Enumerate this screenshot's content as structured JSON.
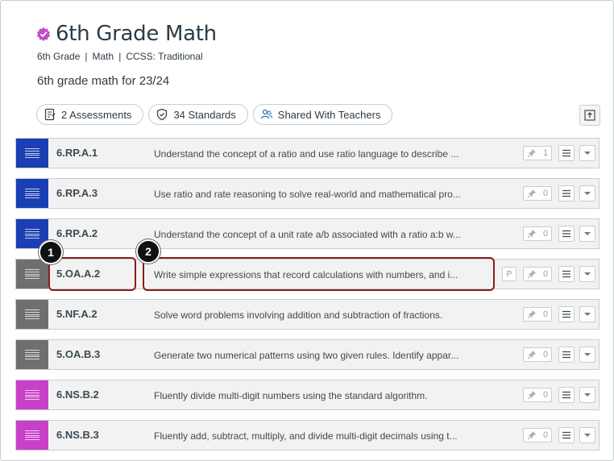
{
  "header": {
    "title": "6th Grade Math",
    "meta": [
      "6th Grade",
      "Math",
      "CCSS: Traditional"
    ],
    "meta_sep": "|",
    "description": "6th grade math for 23/24"
  },
  "pills": [
    {
      "icon": "assessment-icon",
      "label": "2 Assessments"
    },
    {
      "icon": "shield-check-icon",
      "label": "34 Standards"
    },
    {
      "icon": "users-icon",
      "label": "Shared With Teachers"
    }
  ],
  "colors": {
    "verified": "#c04fc6",
    "blue": "#1a3fb4",
    "gray": "#6f6f6f",
    "magenta": "#c840c8",
    "highlight": "#8b1c1c"
  },
  "rows": [
    {
      "code": "6.RP.A.1",
      "statement": "Understand the concept of a ratio and use ratio language to describe ...",
      "count": "1",
      "color": "#1a3fb4"
    },
    {
      "code": "6.RP.A.3",
      "statement": "Use ratio and rate reasoning to solve real-world and mathematical pro...",
      "count": "0",
      "color": "#1a3fb4"
    },
    {
      "code": "6.RP.A.2",
      "statement": "Understand the concept of a unit rate a/b associated with a ratio a:b w...",
      "count": "0",
      "color": "#1a3fb4"
    },
    {
      "code": "5.OA.A.2",
      "statement": "Write simple expressions that record calculations with numbers, and i...",
      "count": "0",
      "color": "#6f6f6f",
      "badge": "P"
    },
    {
      "code": "5.NF.A.2",
      "statement": "Solve word problems involving addition and subtraction of fractions.",
      "count": "0",
      "color": "#6f6f6f"
    },
    {
      "code": "5.OA.B.3",
      "statement": "Generate two numerical patterns using two given rules. Identify appar...",
      "count": "0",
      "color": "#6f6f6f"
    },
    {
      "code": "6.NS.B.2",
      "statement": "Fluently divide multi-digit numbers using the standard algorithm.",
      "count": "0",
      "color": "#c840c8"
    },
    {
      "code": "6.NS.B.3",
      "statement": "Fluently add, subtract, multiply, and divide multi-digit decimals using t...",
      "count": "0",
      "color": "#c840c8"
    }
  ],
  "callouts": [
    "1",
    "2"
  ]
}
